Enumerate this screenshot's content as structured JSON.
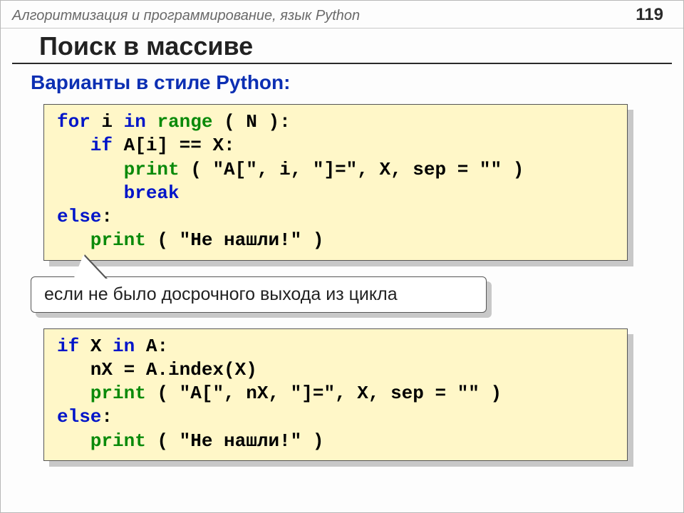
{
  "header": {
    "breadcrumb": "Алгоритмизация и программирование, язык Python",
    "page_number": "119"
  },
  "title": "Поиск в массиве",
  "subtitle": "Варианты в стиле Python:",
  "code1": {
    "l1a": "for",
    "l1b": " i ",
    "l1c": "in",
    "l1d": " ",
    "l1e": "range",
    "l1f": " ( N ):",
    "l2a": "   if",
    "l2b": " A[i] == X:",
    "l3a": "      print",
    "l3b": " ( \"A[\", i, \"]=\", X, sep = \"\" )",
    "l4a": "      break",
    "l5a": "else",
    "l5b": ":",
    "l6a": "   print",
    "l6b": " ( \"Не нашли!\" )"
  },
  "callout": "если не было досрочного выхода из цикла",
  "code2": {
    "l1a": "if",
    "l1b": " X ",
    "l1c": "in",
    "l1d": " A:",
    "l2": "   nX = A.index(X)",
    "l3a": "   print",
    "l3b": " ( \"A[\", nX, \"]=\", X, sep = \"\" )",
    "l4a": "else",
    "l4b": ":",
    "l5a": "   print",
    "l5b": " ( \"Не нашли!\" )"
  }
}
